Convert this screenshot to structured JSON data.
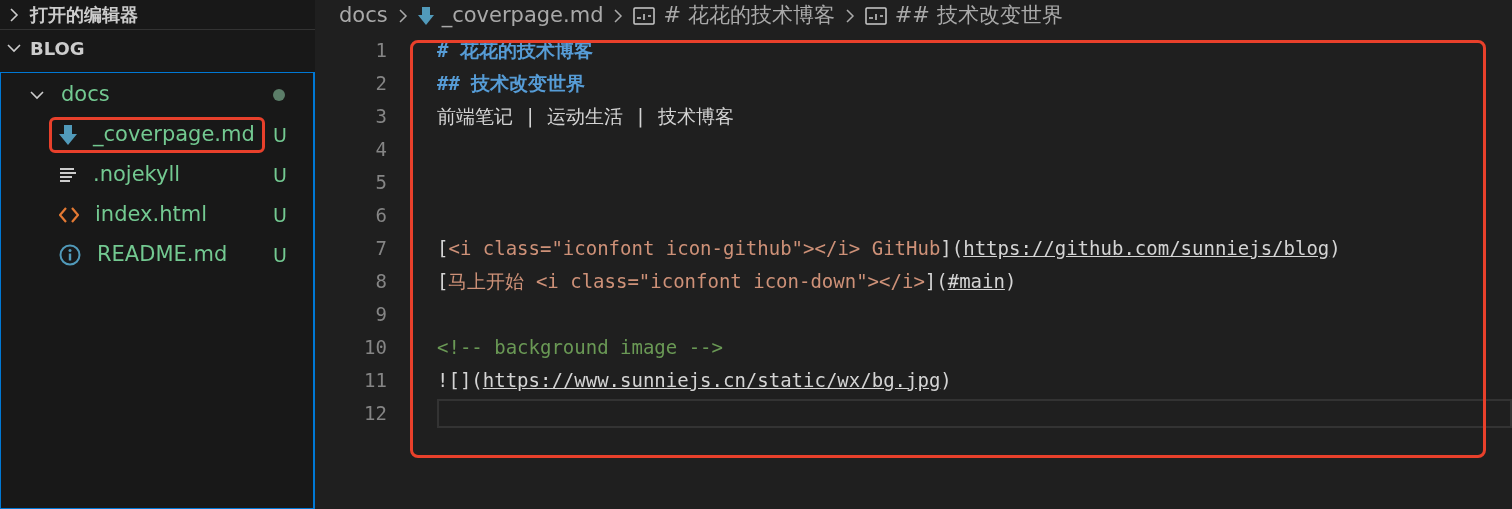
{
  "sidebar": {
    "sections": [
      {
        "title": "打开的编辑器",
        "expanded": false
      },
      {
        "title": "BLOG",
        "expanded": true
      }
    ],
    "tree": [
      {
        "label": "docs",
        "kind": "folder",
        "expanded": true,
        "dot": true,
        "children": [
          {
            "label": "_coverpage.md",
            "kind": "markdown",
            "status": "U",
            "highlighted": true
          },
          {
            "label": ".nojekyll",
            "kind": "text",
            "status": "U",
            "highlighted": false
          },
          {
            "label": "index.html",
            "kind": "html",
            "status": "U",
            "highlighted": false
          },
          {
            "label": "README.md",
            "kind": "info",
            "status": "U",
            "highlighted": false
          }
        ]
      }
    ]
  },
  "breadcrumbs": [
    {
      "label": "docs",
      "kind": "folder"
    },
    {
      "label": "_coverpage.md",
      "kind": "markdown"
    },
    {
      "label": "# 花花的技术博客",
      "kind": "symbol"
    },
    {
      "label": "## 技术改变世界",
      "kind": "symbol"
    }
  ],
  "editor": {
    "highlighted": true,
    "lines": [
      {
        "number": "1",
        "tokens": [
          {
            "kind": "heading",
            "text": "# 花花的技术博客"
          }
        ]
      },
      {
        "number": "2",
        "tokens": [
          {
            "kind": "heading",
            "text": "## 技术改变世界"
          }
        ]
      },
      {
        "number": "3",
        "tokens": [
          {
            "kind": "text",
            "text": "前端笔记 | 运动生活 | 技术博客"
          }
        ]
      },
      {
        "number": "4"
      },
      {
        "number": "5"
      },
      {
        "number": "6"
      },
      {
        "number": "7",
        "tokens": [
          {
            "kind": "text",
            "text": "["
          },
          {
            "kind": "label",
            "text": "<i class=\"iconfont icon-github\"></i> GitHub"
          },
          {
            "kind": "text",
            "text": "]("
          },
          {
            "kind": "link",
            "text": "https://github.com/sunniejs/blog"
          },
          {
            "kind": "text",
            "text": ")"
          }
        ]
      },
      {
        "number": "8",
        "tokens": [
          {
            "kind": "text",
            "text": "["
          },
          {
            "kind": "label",
            "text": "马上开始 <i class=\"iconfont icon-down\"></i>"
          },
          {
            "kind": "text",
            "text": "]("
          },
          {
            "kind": "link",
            "text": "#main"
          },
          {
            "kind": "text",
            "text": ")"
          }
        ]
      },
      {
        "number": "9"
      },
      {
        "number": "10",
        "tokens": [
          {
            "kind": "comment",
            "text": "<!-- background image -->"
          }
        ]
      },
      {
        "number": "11",
        "tokens": [
          {
            "kind": "text",
            "text": "![]("
          },
          {
            "kind": "link",
            "text": "https://www.sunniejs.cn/static/wx/bg.jpg"
          },
          {
            "kind": "text",
            "text": ")"
          }
        ]
      },
      {
        "number": "12",
        "current": true
      }
    ]
  }
}
